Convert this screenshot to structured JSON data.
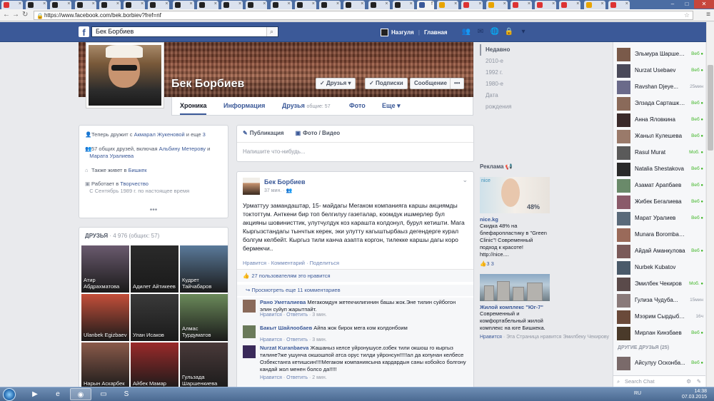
{
  "browser": {
    "url": "https://www.facebook.com/bek.borbiev?fref=nf",
    "active_tab_label": "f"
  },
  "fb": {
    "search_value": "Бек Борбиев",
    "user_nav": "Назгуля",
    "home": "Главная"
  },
  "profile": {
    "name": "Бек Борбиев",
    "friends_btn": "Друзья",
    "subscribe_btn": "Подписки",
    "message_btn": "Сообщение",
    "more_btn": "•••",
    "tabs": {
      "timeline": "Хроника",
      "info": "Информация",
      "friends": "Друзья",
      "friends_count": "общие: 57",
      "photos": "Фото",
      "more": "Еще"
    }
  },
  "years": [
    "Недавно",
    "2010-е",
    "1992 г.",
    "1980-е",
    "Дата рождения"
  ],
  "intro": {
    "row1_pre": "Теперь дружит с ",
    "row1_link": "Акмарал Жукеновой",
    "row1_mid": " и еще ",
    "row1_link2": "3",
    "row2_pre": "57 общих друзей, включая ",
    "row2_link": "Альбину Метерову",
    "row2_mid": " и ",
    "row2_link2": "Марата Уралиева",
    "row3_pre": "Также живет в ",
    "row3_link": "Бишкек",
    "row4_pre": "Работает в ",
    "row4_link": "Творчество",
    "row4_sub": "С Сентябрь 1989 г. по настоящее время",
    "more": "•••"
  },
  "friends": {
    "header": "ДРУЗЬЯ",
    "count": " · 4 976 (общих: 57)",
    "list": [
      {
        "name": "Атир Абдрахматова",
        "color": "#6a5a6e"
      },
      {
        "name": "Адилет Айтикеев",
        "color": "#2a2a2a"
      },
      {
        "name": "Кудрет Тайчабаров",
        "color": "#5a7a9a"
      },
      {
        "name": "Ulanbek Egizbaev",
        "color": "#c44f3a"
      },
      {
        "name": "Улан Исаков",
        "color": "#3a3a3a"
      },
      {
        "name": "Алмас Турдуматов",
        "color": "#6b8a5a"
      },
      {
        "name": "Нарын Аскарбек",
        "color": "#8a5a4a"
      },
      {
        "name": "Айбек Мамар",
        "color": "#9a2a2a"
      },
      {
        "name": "Гульзада Шаршенкиева",
        "color": "#4a3a3a"
      }
    ]
  },
  "composer": {
    "tab1": "Публикация",
    "tab2": "Фото / Видео",
    "placeholder": "Напишите что-нибудь..."
  },
  "post": {
    "author": "Бек Борбиев",
    "time": "37 мин.",
    "text": "Урматтуу замандаштар, 15- майдагы Мегаком компанияга каршы акциямды токтоттум. Анткени бир топ белгилуу газеталар, коомдук ишмерлер бул акцияны шовинисттик, улутчулдук коз караштa колдонул, бурул кетишти. Мага Кыргызстандагы тынчтык керек, эки улутту кагыштырбаыз дегендерге курал болгум келбейт. Кыргыз тили канча азаптa коргон, тилекке каршы дагы коро бермекчи..",
    "actions": "Нравится · Комментарий · Поделиться",
    "likes": "27 пользователям это нравится",
    "more_comments": "Просмотреть еще 11 комментариев",
    "comments": [
      {
        "author": "Рано Уметалиева",
        "text": " Мегакомдун жетекчилигинин башы жок.Эне тилин суйбогон элин суйуп жарытпайт.",
        "time": "3 мин."
      },
      {
        "author": "Бакыт Шайлообаев",
        "text": " Айпа жок бирок мега ком колдонбоим",
        "time": "3 мин."
      },
      {
        "author": "Nurzat Kuranbaeva",
        "text": " Жашаныз келсе уйронушусе.озбек тили окшош го кыргыз тилине?же ушунча окшошпой атса орус тилди уйронсун!!!!!ал да копунан келбесе Озбекстанга кетишсин!!!!Мегаком компаниясына кардардын саны кобойсо болгону кандай жол менен болсо да!!!!!",
        "time": "2 мин."
      }
    ],
    "c_like": "Нравится",
    "c_reply": "Ответить"
  },
  "ads": {
    "header": "Реклама",
    "ad1_pct": "48%",
    "ad1_logo": "nice",
    "ad1_title": "nice.kg",
    "ad1_desc": "Скидка 48% на блефаропластику в \"Green Clinic\"! Современный подход к красоте! http://nice....",
    "ad1_stats": "3  3",
    "ad2_title": "Жилой комплекс \"Юг-7\"",
    "ad2_desc": "Современный и комфортабельный жилой комплекс на юге Бишкека.",
    "ad2_like": "Нравится",
    "ad2_foot": " · Эта Страница нравится Эмилбеку Чекирову"
  },
  "chat": {
    "contacts": [
      {
        "name": "Эльмура Шаршеева",
        "status": "Веб",
        "color": "#7a5a4a"
      },
      {
        "name": "Nurzat Usebaev",
        "status": "Веб",
        "color": "#4a4a5a"
      },
      {
        "name": "Ravshan Djeye...",
        "status": "25мин",
        "idle": true,
        "color": "#6a6a8a"
      },
      {
        "name": "Элзада Сарташка...",
        "status": "Веб",
        "color": "#8a6a5a"
      },
      {
        "name": "Анна Яловкина",
        "status": "Веб",
        "color": "#3a2a2a"
      },
      {
        "name": "Жаныл Кулешева",
        "status": "Веб",
        "color": "#9a7a6a"
      },
      {
        "name": "Rasul Murat",
        "status": "Моб.",
        "color": "#5a5a5a"
      },
      {
        "name": "Natalia Shestakova",
        "status": "Веб",
        "color": "#2a2a2a"
      },
      {
        "name": "Азамат Арапбаев",
        "status": "Веб",
        "color": "#6a8a6a"
      },
      {
        "name": "Жибек Бегалиева",
        "status": "Веб",
        "color": "#8a5a6a"
      },
      {
        "name": "Марат Уралиев",
        "status": "Веб",
        "color": "#5a6a7a"
      },
      {
        "name": "Munara Borombaeva",
        "status": "",
        "none": true,
        "color": "#9a6a5a"
      },
      {
        "name": "Айдай Аманкулова",
        "status": "Веб",
        "color": "#7a5a5a"
      },
      {
        "name": "Nurbek Kubatov",
        "status": "",
        "none": true,
        "color": "#4a5a6a"
      },
      {
        "name": "Эмилбек Чекиров",
        "status": "Моб.",
        "color": "#5a4a4a"
      },
      {
        "name": "Гулиза Чудуба...",
        "status": "15мин",
        "idle": true,
        "color": "#8a7a7a"
      },
      {
        "name": "Мээрим Сырдыбаева",
        "status": "16ч",
        "idle": true,
        "color": "#6a4a3a"
      },
      {
        "name": "Мирлан Кинзбаев",
        "status": "Веб",
        "color": "#4a3a2a"
      }
    ],
    "other_header": "ДРУГИЕ ДРУЗЬЯ (25)",
    "other_first": {
      "name": "Айсулуу Осконба...",
      "status": "Веб",
      "color": "#7a6a6a"
    },
    "search_placeholder": "Search Chat"
  },
  "taskbar": {
    "lang": "RU",
    "time": "14:38",
    "date": "07.03.2015"
  }
}
